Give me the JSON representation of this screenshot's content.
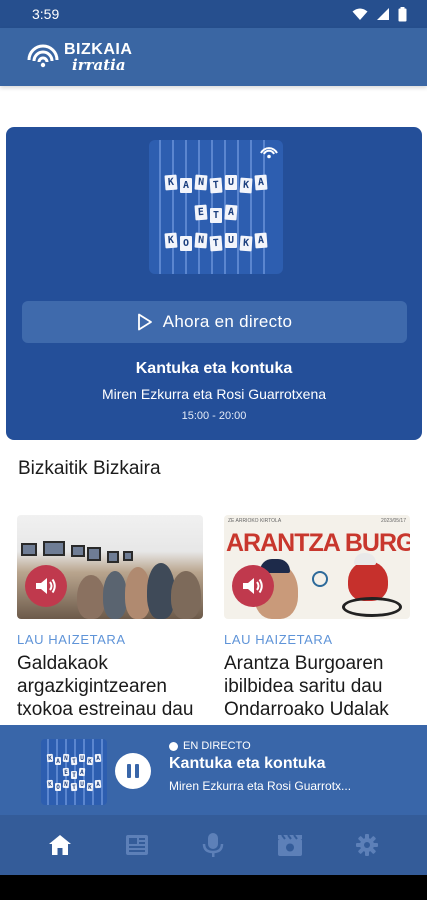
{
  "status_bar": {
    "time": "3:59",
    "icons": [
      "wifi-icon",
      "signal-icon",
      "battery-icon"
    ]
  },
  "header": {
    "logo_top": "BIZKAIA",
    "logo_bottom": "irratia"
  },
  "live": {
    "cover_tiles": [
      "K",
      "A",
      "N",
      "T",
      "U",
      "K",
      "A",
      "E",
      "T",
      "A",
      "K",
      "O",
      "N",
      "T",
      "U",
      "K",
      "A"
    ],
    "button_label": "Ahora en directo",
    "show_title": "Kantuka eta kontuka",
    "show_hosts": "Miren Ezkurra eta Rosi Guarrotxena",
    "show_time": "15:00 - 20:00"
  },
  "section": {
    "title": "Bizkaitik Bizkaira"
  },
  "news": [
    {
      "category": "LAU HAIZETARA",
      "title": "Galdakaok argazkigintzearen txokoa estreinau dau"
    },
    {
      "category": "LAU HAIZETARA",
      "title": "Arantza Burgoaren ibilbidea saritu dau Ondarroako Udalak",
      "thumb_headline": "ARANTZA BURGOA",
      "thumb_kicker": "ZE ARRIOKO KIRTOLA",
      "thumb_date": "2023/05/17"
    }
  ],
  "mini_player": {
    "live_label": "EN DIRECTO",
    "title": "Kantuka eta kontuka",
    "hosts": "Miren Ezkurra eta Rosi Guarrotx..."
  },
  "nav": {
    "items": [
      "home-icon",
      "news-icon",
      "microphone-icon",
      "agenda-icon",
      "settings-icon"
    ],
    "active_index": 0
  },
  "colors": {
    "brand_blue": "#244f99",
    "header_blue": "#3a66a3",
    "accent_red": "#c0394d",
    "category_blue": "#5f94d8"
  }
}
